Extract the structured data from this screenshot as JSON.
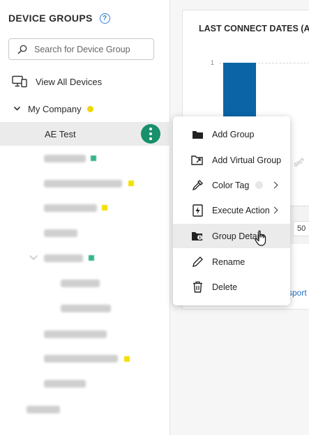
{
  "sidebar": {
    "title": "DEVICE GROUPS",
    "help_glyph": "?",
    "search": {
      "placeholder": "Search for Device Group"
    },
    "view_all": "View All Devices",
    "company": "My Company",
    "selected_group": "AE Test",
    "blurred_rows": 11
  },
  "main": {
    "card_title": "LAST CONNECT DATES (ALL",
    "y_tick": "1",
    "x_tick": "days",
    "cell_value": "50",
    "export_link": "sport"
  },
  "menu": {
    "items": [
      {
        "label": "Add Group",
        "icon": "folder-icon"
      },
      {
        "label": "Add Virtual Group",
        "icon": "folder-link-icon"
      },
      {
        "label": "Color Tag",
        "icon": "eyedropper-icon",
        "submenu": true
      },
      {
        "label": "Execute Action",
        "icon": "lightning-file-icon",
        "submenu": true
      },
      {
        "label": "Group Details",
        "icon": "folder-info-icon",
        "hovered": true
      },
      {
        "label": "Rename",
        "icon": "pencil-icon"
      },
      {
        "label": "Delete",
        "icon": "trash-icon"
      }
    ]
  },
  "colors": {
    "accent_green": "#17906b",
    "bar_blue": "#0a64a5",
    "tag_yellow": "#f1d600",
    "tag_green": "#39b48b",
    "link_blue": "#1f6fc5"
  }
}
